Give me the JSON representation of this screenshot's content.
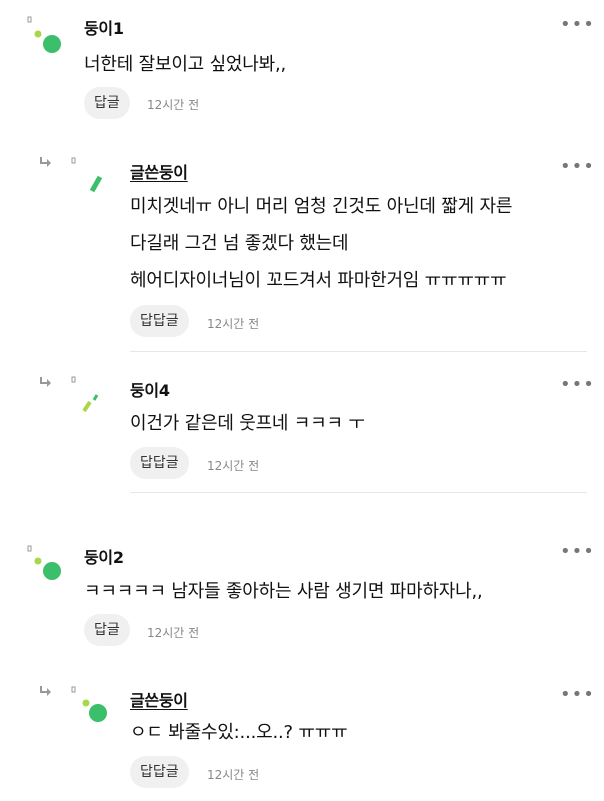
{
  "colors": {
    "accent_green": "#3cbf6a",
    "light_green": "#a8d74a",
    "text": "#111111",
    "muted": "#888888"
  },
  "menu_label": "•••",
  "comments": [
    {
      "author": "둥이1",
      "lines": [
        "너한테 잘보이고 싶었나봐,,"
      ],
      "reply_label": "답글",
      "time": "12시간 전"
    },
    {
      "author": "글쓴둥이",
      "lines": [
        "미치겟네ㅠ 아니 머리 엄청 긴것도 아닌데 짧게 자른",
        "다길래 그건 넘 좋겠다 했는데",
        "헤어디자이너님이 꼬드겨서 파마한거임 ㅠㅠㅠㅠㅠ"
      ],
      "reply_label": "답답글",
      "time": "12시간 전"
    },
    {
      "author": "둥이4",
      "lines": [
        "이건가 같은데 웃프네 ㅋㅋㅋ ㅜ"
      ],
      "reply_label": "답답글",
      "time": "12시간 전"
    },
    {
      "author": "둥이2",
      "lines": [
        "ㅋㅋㅋㅋㅋ 남자들 좋아하는 사람 생기면 파마하자나,,"
      ],
      "reply_label": "답글",
      "time": "12시간 전"
    },
    {
      "author": "글쓴둥이",
      "lines": [
        "ㅇㄷ 봐줄수있:...오..? ㅠㅠㅠ"
      ],
      "reply_label": "답답글",
      "time": "12시간 전"
    }
  ]
}
